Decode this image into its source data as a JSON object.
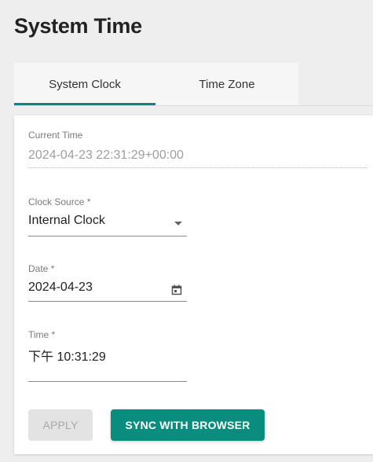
{
  "page": {
    "title": "System Time"
  },
  "tabs": [
    {
      "label": "System Clock",
      "active": true
    },
    {
      "label": "Time Zone",
      "active": false
    }
  ],
  "form": {
    "current_time": {
      "label": "Current Time",
      "value": "2024-04-23 22:31:29+00:00"
    },
    "clock_source": {
      "label": "Clock Source *",
      "value": "Internal Clock"
    },
    "date": {
      "label": "Date *",
      "value": "2024-04-23"
    },
    "time": {
      "label": "Time *",
      "value": "下午 10:31:29"
    }
  },
  "buttons": {
    "apply": {
      "label": "APPLY",
      "enabled": false
    },
    "sync": {
      "label": "SYNC WITH BROWSER",
      "enabled": true
    }
  },
  "colors": {
    "accent": "#008787",
    "primary_button": "#0a8c7f",
    "disabled_button": "#e3e3e3",
    "background": "#eeeeee"
  },
  "icons": {
    "dropdown": "chevron-down-icon",
    "date_picker": "calendar-icon"
  }
}
